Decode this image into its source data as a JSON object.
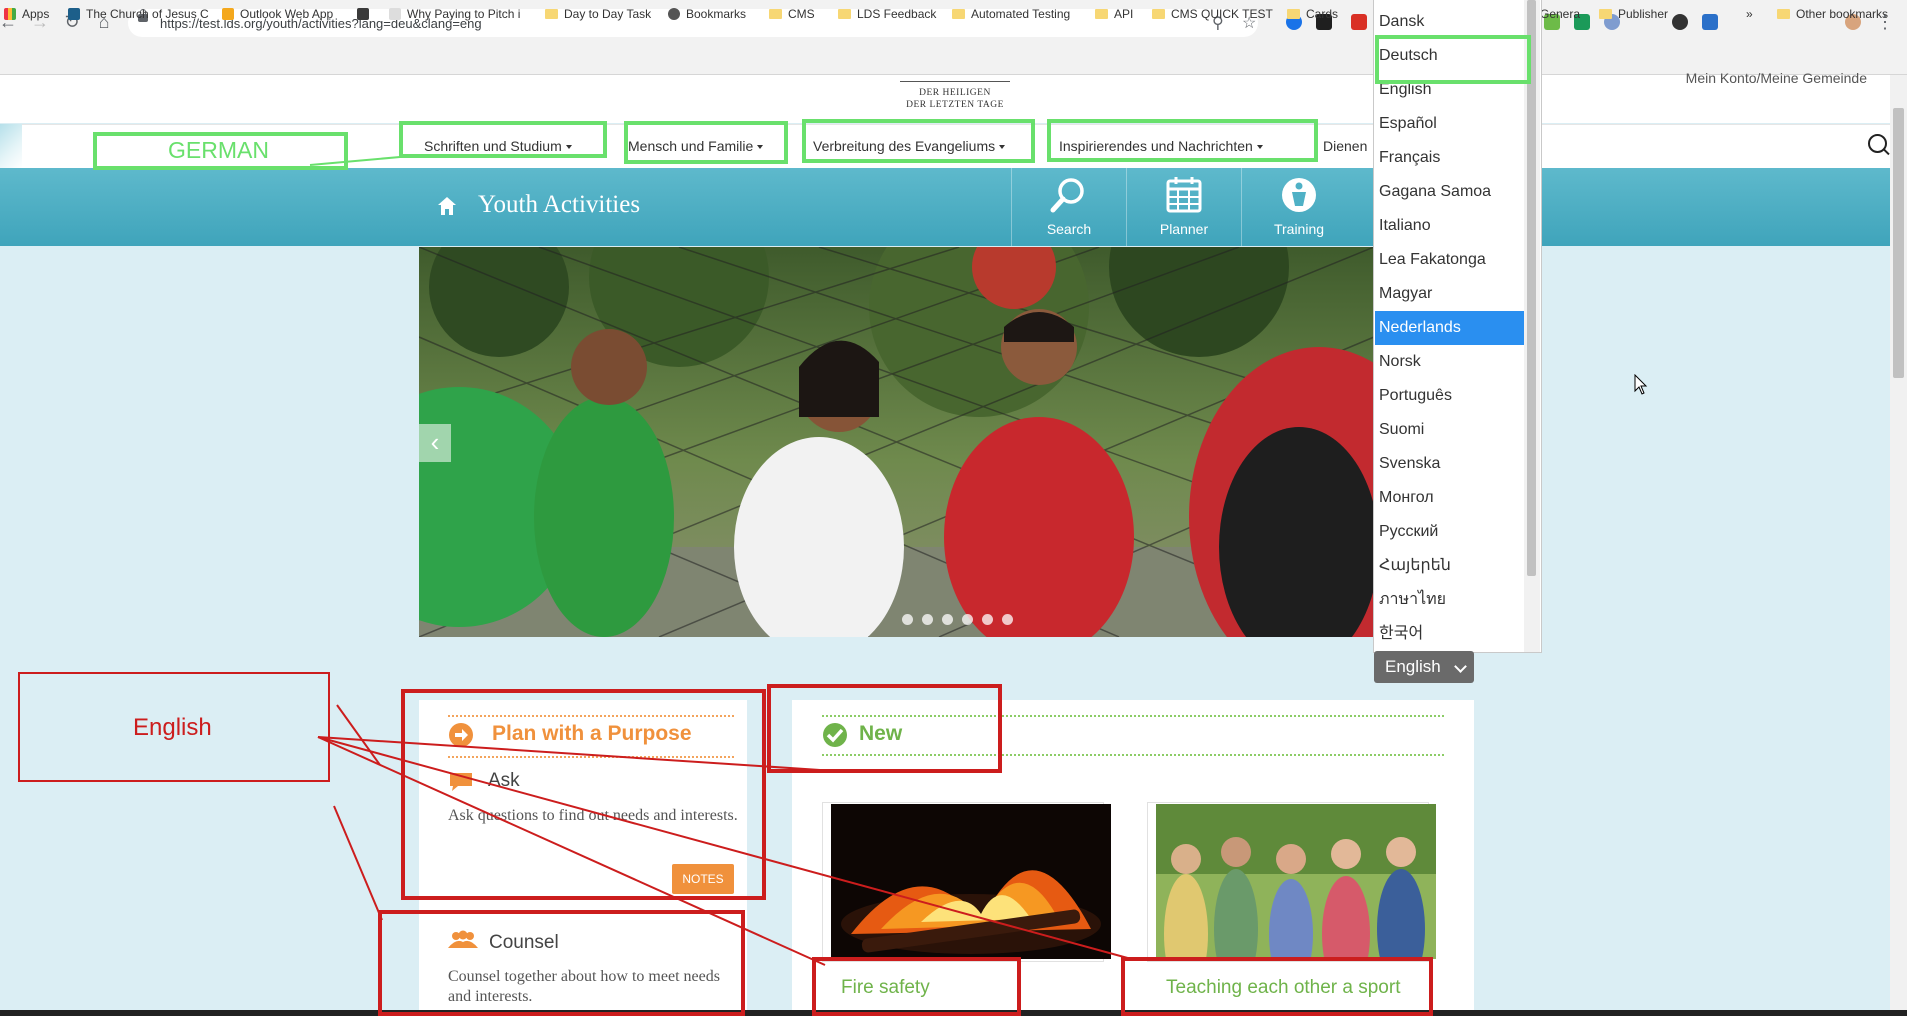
{
  "browser": {
    "url": "https://test.lds.org/youth/activities?lang=deu&clang=eng",
    "bookmarks": [
      "Apps",
      "The Church of Jesus C",
      "Outlook Web App",
      "Why Paying to Pitch i",
      "Day to Day Task",
      "Bookmarks",
      "CMS",
      "LDS Feedback",
      "Automated Testing",
      "API",
      "CMS QUICK TEST",
      "Cards",
      "Genera",
      "Publisher",
      "Other bookmarks"
    ],
    "overflow_chevron": "»"
  },
  "site": {
    "logo_line1": "DER HEILIGEN",
    "logo_line2": "DER LETZTEN TAGE",
    "account_link": "Mein Konto/Meine Gemeinde",
    "nav": [
      "Schriften und Studium",
      "Mensch und Familie",
      "Verbreitung des Evangeliums",
      "Inspirierendes und Nachrichten",
      "Dienen"
    ]
  },
  "youth": {
    "title": "Youth Activities",
    "tools": [
      "Search",
      "Planner",
      "Training"
    ]
  },
  "plan": {
    "title": "Plan with a Purpose",
    "ask_title": "Ask",
    "ask_text": "Ask questions to find out needs and interests.",
    "notes_label": "NOTES",
    "counsel_title": "Counsel",
    "counsel_text": "Counsel together about how to meet needs and interests."
  },
  "new": {
    "title": "New",
    "items": [
      "Fire safety",
      "Teaching each other a sport"
    ]
  },
  "language": {
    "options": [
      "Dansk",
      "Deutsch",
      "English",
      "Español",
      "Français",
      "Gagana Samoa",
      "Italiano",
      "Lea Fakatonga",
      "Magyar",
      "Nederlands",
      "Norsk",
      "Português",
      "Suomi",
      "Svenska",
      "Монгол",
      "Русский",
      "Հայերեն",
      "ภาษาไทย",
      "한국어"
    ],
    "highlighted": "Nederlands",
    "current": "English"
  },
  "annotations": {
    "german_label": "GERMAN",
    "english_label": "English",
    "green": "#69e06c",
    "red": "#cc1d1d"
  },
  "colors": {
    "teal": "#4fb1c6",
    "orange": "#f0913c",
    "green": "#6fb34a",
    "selected_blue": "#2a8ff0"
  }
}
